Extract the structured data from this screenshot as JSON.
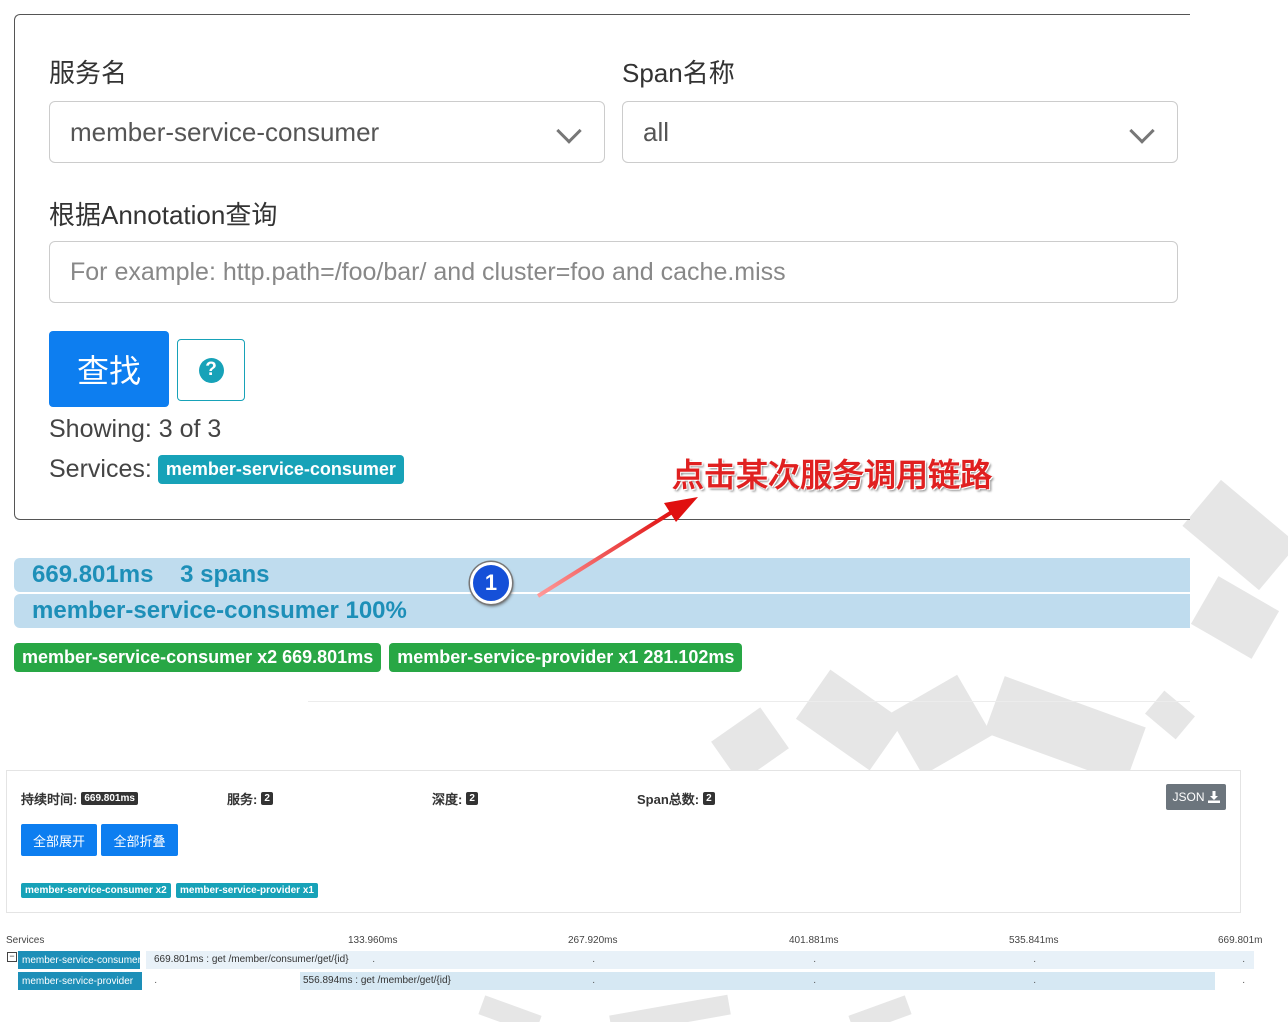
{
  "search": {
    "service_label": "服务名",
    "service_value": "member-service-consumer",
    "span_label": "Span名称",
    "span_value": "all",
    "annotation_label": "根据Annotation查询",
    "annotation_placeholder": "For example: http.path=/foo/bar/ and cluster=foo and cache.miss",
    "find_button": "查找",
    "help_icon": "?",
    "showing": "Showing: 3 of 3",
    "services_label": "Services:",
    "services_badge": "member-service-consumer"
  },
  "annotation": {
    "text": "点击某次服务调用链路",
    "number": "1"
  },
  "result": {
    "duration_spans": "669.801ms    3 spans",
    "service_percent": "member-service-consumer 100%",
    "badges": [
      "member-service-consumer x2 669.801ms",
      "member-service-provider x1 281.102ms"
    ]
  },
  "trace": {
    "duration_label": "持续时间:",
    "duration_value": "669.801ms",
    "services_label": "服务:",
    "services_value": "2",
    "depth_label": "深度:",
    "depth_value": "2",
    "span_total_label": "Span总数:",
    "span_total_value": "2",
    "json_button": "JSON",
    "expand_all": "全部展开",
    "collapse_all": "全部折叠",
    "service_tags": [
      "member-service-consumer x2",
      "member-service-provider x1"
    ],
    "timeline_header": "Services",
    "ticks": [
      "133.960ms",
      "267.920ms",
      "401.881ms",
      "535.841ms",
      "669.801m"
    ],
    "rows": [
      {
        "service": "member-service-consumer",
        "label": "669.801ms : get /member/consumer/get/{id}"
      },
      {
        "service": "member-service-provider",
        "label": "556.894ms : get /member/get/{id}"
      }
    ]
  },
  "colors": {
    "primary": "#0d7ef0",
    "teal": "#17a2b8",
    "success": "#28a745",
    "result_bg": "#bfdcee",
    "annotation_red": "#e02020"
  }
}
